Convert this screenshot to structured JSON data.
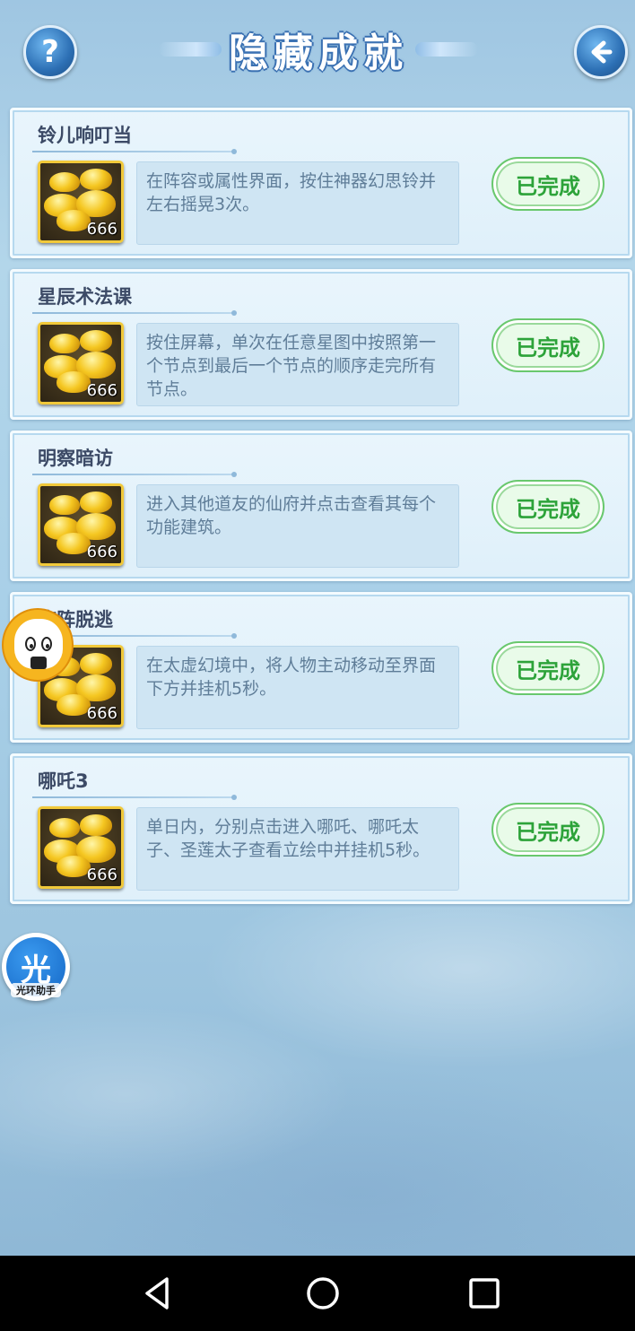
{
  "header": {
    "title": "隐藏成就",
    "help_icon": "question-mark-icon",
    "back_icon": "back-arrow-icon"
  },
  "achievements": [
    {
      "title": "铃儿响叮当",
      "description": "在阵容或属性界面，按住神器幻思铃并左右摇晃3次。",
      "reward_count": "666",
      "status": "已完成"
    },
    {
      "title": "星辰术法课",
      "description": "按住屏幕，单次在任意星图中按照第一个节点到最后一个节点的顺序走完所有节点。",
      "reward_count": "666",
      "status": "已完成"
    },
    {
      "title": "明察暗访",
      "description": "进入其他道友的仙府并点击查看其每个功能建筑。",
      "reward_count": "666",
      "status": "已完成"
    },
    {
      "title": "临阵脱逃",
      "description": "在太虚幻境中，将人物主动移动至界面下方并挂机5秒。",
      "reward_count": "666",
      "status": "已完成"
    },
    {
      "title": "哪吒3",
      "description": "单日内，分别点击进入哪吒、哪吒太子、圣莲太子查看立绘中并挂机5秒。",
      "reward_count": "666",
      "status": "已完成"
    }
  ],
  "overlays": {
    "floating_mascot_icon": "onigiri-mascot-icon",
    "helper_badge": {
      "glyph": "光",
      "label": "光环助手"
    }
  },
  "navbar": {
    "back_icon": "triangle-back-icon",
    "home_icon": "circle-home-icon",
    "recent_icon": "square-recents-icon"
  },
  "colors": {
    "done_text": "#2da33a",
    "card_bg": "#e9f5fc",
    "title_text": "#3c4a66",
    "desc_text": "#5f7d98"
  }
}
